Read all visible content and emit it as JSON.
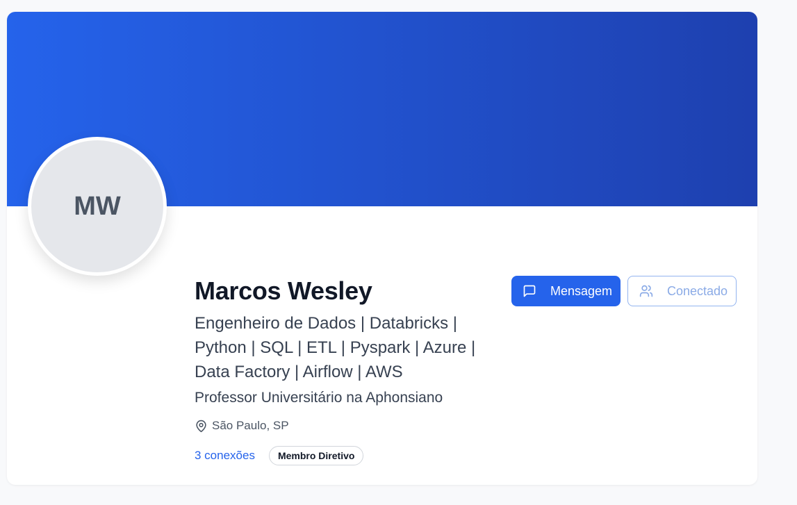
{
  "profile": {
    "initials": "MW",
    "name": "Marcos Wesley",
    "headline": "Engenheiro de Dados | Databricks | Python | SQL | ETL | Pyspark | Azure | Data Factory | Airflow | AWS",
    "subtitle": "Professor Universitário na Aphonsiano",
    "location": "São Paulo, SP",
    "connections": "3 conexões",
    "badge": "Membro Diretivo"
  },
  "actions": {
    "message_label": "Mensagem",
    "message_icon": "message-square-icon",
    "connected_label": "Conectado",
    "connected_icon": "users-icon"
  },
  "icons": {
    "location": "map-pin-icon"
  },
  "colors": {
    "banner_start": "#2563eb",
    "banner_end": "#1e40af",
    "primary": "#2563eb",
    "avatar_bg": "#e5e7eb"
  }
}
